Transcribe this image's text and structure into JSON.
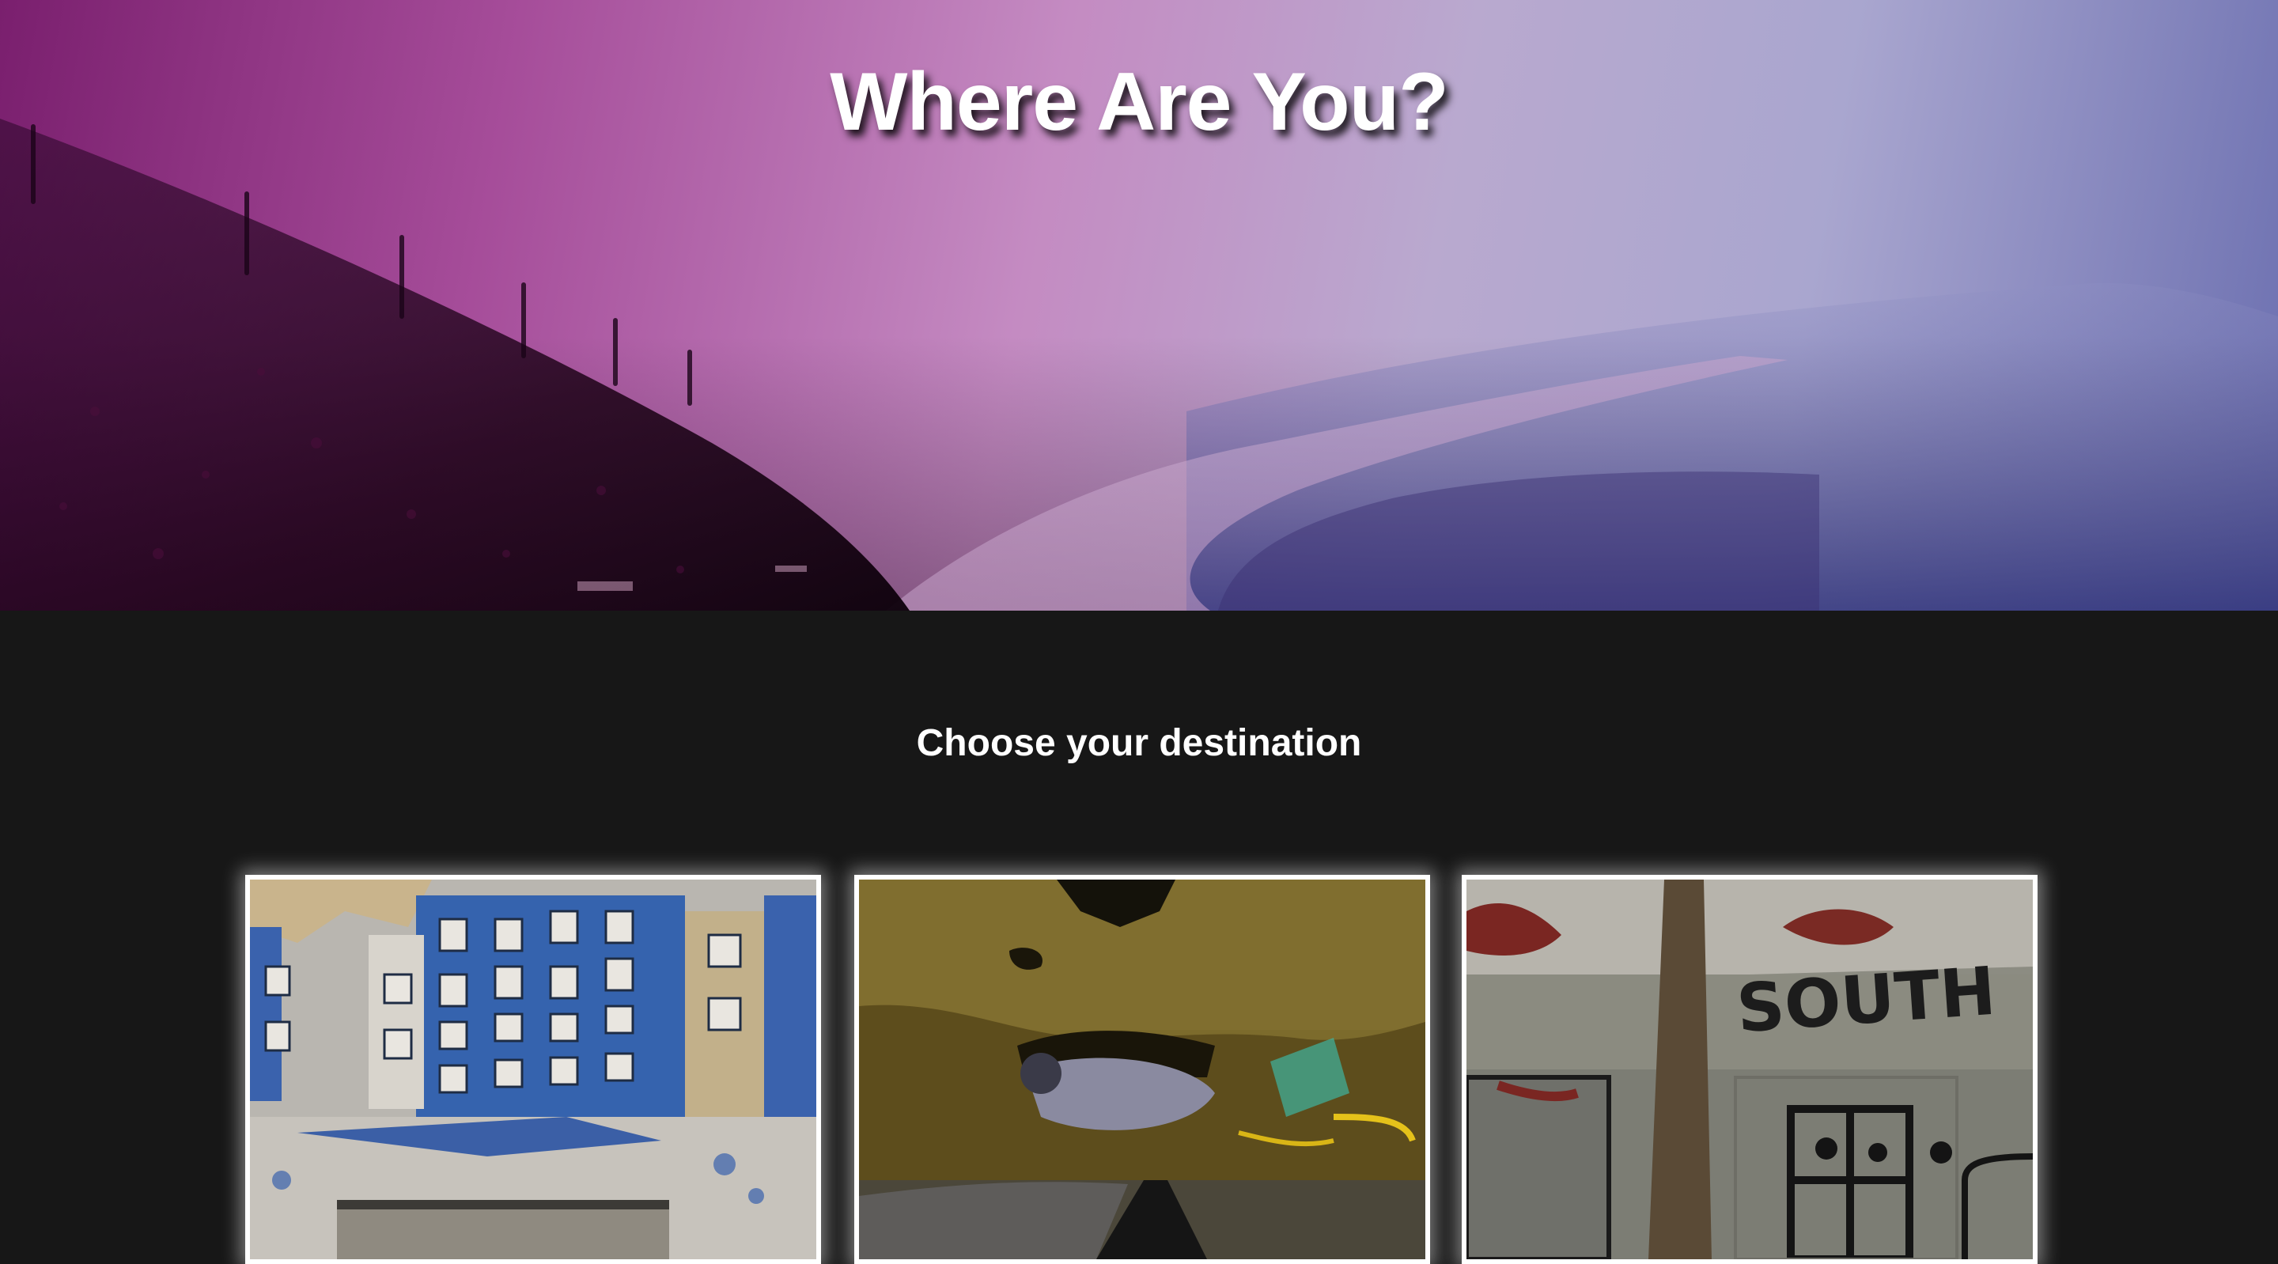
{
  "hero": {
    "title": "Where Are You?"
  },
  "destinations": {
    "heading": "Choose your destination",
    "cards": [
      {
        "name": "building",
        "sign": ""
      },
      {
        "name": "road",
        "sign": ""
      },
      {
        "name": "south",
        "sign": "SOUTH"
      }
    ]
  },
  "colors": {
    "page_background": "#171717",
    "hero_magenta": "#a64d9a",
    "hero_lavender": "#b9a9cf",
    "hero_blue": "#6b6fb0",
    "card_border": "#ffffff"
  }
}
